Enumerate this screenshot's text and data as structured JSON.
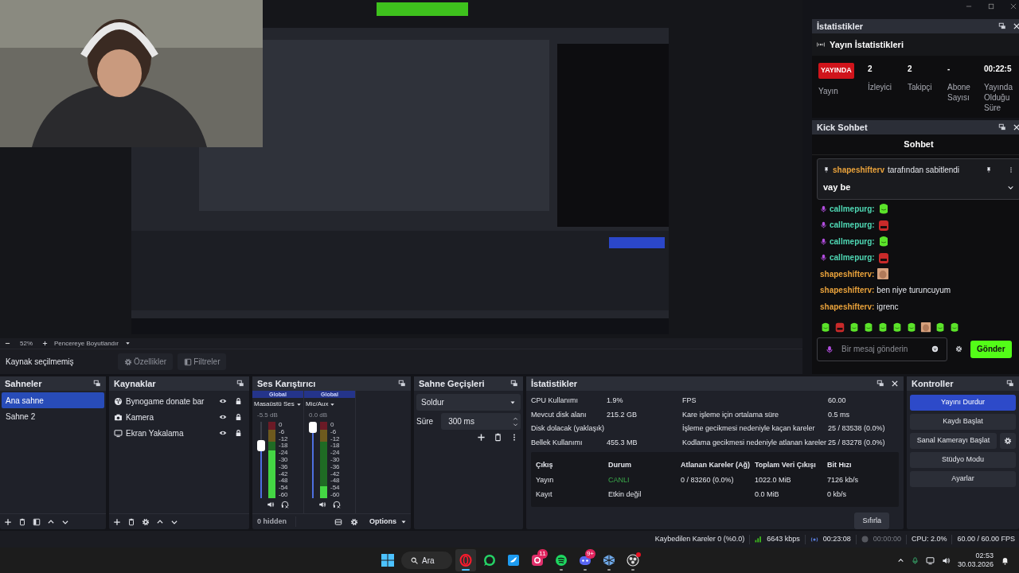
{
  "stream_stats_dock": {
    "title": "İstatistikler",
    "heading": "Yayın İstatistikleri",
    "status_badge": "YAYINDA",
    "status_label": "Yayın",
    "metrics": [
      {
        "value": "2",
        "label": "İzleyici"
      },
      {
        "value": "2",
        "label": "Takipçi"
      },
      {
        "value": "-",
        "label": "Abone Sayısı"
      },
      {
        "value": "00:22:5",
        "label": "Yayında Olduğu Süre"
      }
    ]
  },
  "chat_dock": {
    "title": "Kick Sohbet",
    "heading": "Sohbet",
    "pinned": {
      "author": "shapeshifterv",
      "note": "tarafından sabitlendi",
      "text": "vay be"
    },
    "messages": [
      {
        "kind": "emote",
        "author": "callmepurg:",
        "color": "#4fd8b4",
        "badge": true
      },
      {
        "kind": "emote",
        "author": "callmepurg:",
        "color": "#4fd8b4",
        "badge": true
      },
      {
        "kind": "emote",
        "author": "callmepurg:",
        "color": "#4fd8b4",
        "badge": true
      },
      {
        "kind": "emote",
        "author": "callmepurg:",
        "color": "#4fd8b4",
        "badge": true
      },
      {
        "kind": "emote",
        "author": "shapeshifterv:",
        "color": "#e9a23b",
        "badge": false
      },
      {
        "kind": "text",
        "author": "shapeshifterv:",
        "color": "#e9a23b",
        "badge": false,
        "text": "ben niye turuncuyum"
      },
      {
        "kind": "text",
        "author": "shapeshifterv:",
        "color": "#e9a23b",
        "badge": false,
        "text": "igrenc"
      }
    ],
    "placeholder": "Bir mesaj gönderin",
    "send": "Gönder"
  },
  "zoom_bar": {
    "zoom": "52%",
    "fit_label": "Pencereye Boyutlandır"
  },
  "context_bar": {
    "status": "Kaynak seçilmemiş",
    "buttons": [
      {
        "label": "Özellikler",
        "kind": "gear",
        "disabled": true
      },
      {
        "label": "Filtreler",
        "kind": "filter",
        "disabled": true
      }
    ]
  },
  "scenes": {
    "title": "Sahneler",
    "items": [
      {
        "label": "Ana sahne",
        "selected": true
      },
      {
        "label": "Sahne 2",
        "selected": false
      }
    ]
  },
  "sources": {
    "title": "Kaynaklar",
    "items": [
      {
        "label": "Bynogame donate bar",
        "kind": "browser",
        "visible": true,
        "locked": true
      },
      {
        "label": "Kamera",
        "kind": "camera",
        "visible": true,
        "locked": true
      },
      {
        "label": "Ekran Yakalama",
        "kind": "display",
        "visible": true,
        "locked": true
      }
    ]
  },
  "mixer": {
    "title": "Ses Karıştırıcı",
    "hidden": "0 hidden",
    "options": "Options",
    "channels": [
      {
        "scope": "Global",
        "name": "Masaüstü Ses",
        "reading": "-5.5 dB",
        "fader": {
          "level": 0.72
        },
        "meter": {
          "level": 0.63
        },
        "scale": [
          "0",
          "-6",
          "-12",
          "-18",
          "-24",
          "-30",
          "-36",
          "-42",
          "-48",
          "-54",
          "-60"
        ]
      },
      {
        "scope": "Global",
        "name": "Mic/Aux",
        "reading": "0.0 dB",
        "fader": {
          "level": 1
        },
        "meter": {
          "level": 0.16
        },
        "scale": [
          "0",
          "-6",
          "-12",
          "-18",
          "-24",
          "-30",
          "-36",
          "-42",
          "-48",
          "-54",
          "-60"
        ]
      }
    ]
  },
  "transitions": {
    "title": "Sahne Geçişleri",
    "transition": "Soldur",
    "duration_label": "Süre",
    "duration": "300 ms"
  },
  "stats": {
    "title": "İstatistikler",
    "left": [
      {
        "label": "CPU Kullanımı",
        "value": "1.9%"
      },
      {
        "label": "Mevcut disk alanı",
        "value": "215.2 GB"
      },
      {
        "label": "Disk dolacak (yaklaşık)"
      },
      {
        "label": "Bellek Kullanımı",
        "value": "455.3 MB"
      }
    ],
    "right": [
      {
        "label": "FPS",
        "value": "60.00"
      },
      {
        "label": "Kare işleme için ortalama süre",
        "value": "0.5 ms"
      },
      {
        "label": "İşleme gecikmesi nedeniyle kaçan kareler",
        "value": "25 / 83538 (0.0%)"
      },
      {
        "label": "Kodlama gecikmesi nedeniyle atlanan kareler",
        "value": "25 / 83278 (0.0%)"
      }
    ],
    "columns": [
      "Çıkış",
      "Durum",
      "Atlanan Kareler (Ağ)",
      "Toplam Veri Çıkışı",
      "Bit Hızı"
    ],
    "rows": [
      {
        "kind": "live",
        "cells": [
          "Yayın",
          "CANLI",
          "0 / 83260 (0.0%)",
          "1022.0 MiB",
          "7126 kb/s"
        ]
      },
      {
        "kind": "inactive",
        "cells": [
          "Kayıt",
          "Etkin değil",
          "",
          "0.0 MiB",
          "0 kb/s"
        ]
      }
    ],
    "reset": "Sıfırla"
  },
  "controls": {
    "title": "Kontroller",
    "buttons": [
      {
        "label": "Yayını Durdur",
        "active": true,
        "kind": "plain"
      },
      {
        "label": "Kaydı Başlat",
        "active": false,
        "kind": "plain"
      },
      {
        "label": "Sanal Kamerayı Başlat",
        "active": false,
        "kind": "with_settings"
      },
      {
        "label": "Stüdyo Modu",
        "active": false,
        "kind": "plain"
      },
      {
        "label": "Ayarlar",
        "active": false,
        "kind": "plain"
      }
    ]
  },
  "status_bar": {
    "dropped": "Kaybedilen Kareler 0 (%0.0)",
    "bitrate": "6643 kbps",
    "stream_time": "00:23:08",
    "record_time": "00:00:00",
    "cpu": "CPU: 2.0%",
    "fps": "60.00 / 60.00 FPS"
  },
  "taskbar": {
    "search": "Ara",
    "apps": [
      {
        "kind": "opera",
        "active": true,
        "running": true
      },
      {
        "kind": "whatsapp",
        "active": false,
        "running": false
      },
      {
        "kind": "twitter",
        "active": false,
        "running": false
      },
      {
        "kind": "instagram",
        "active": false,
        "running": false,
        "badge": "11"
      },
      {
        "kind": "spotify",
        "active": false,
        "running": true
      },
      {
        "kind": "discord",
        "active": false,
        "running": true,
        "badge": "9+"
      },
      {
        "kind": "cube",
        "active": false,
        "running": true
      },
      {
        "kind": "obs",
        "active": false,
        "running": true
      }
    ],
    "time": "02:53",
    "date": "30.03.2026"
  }
}
